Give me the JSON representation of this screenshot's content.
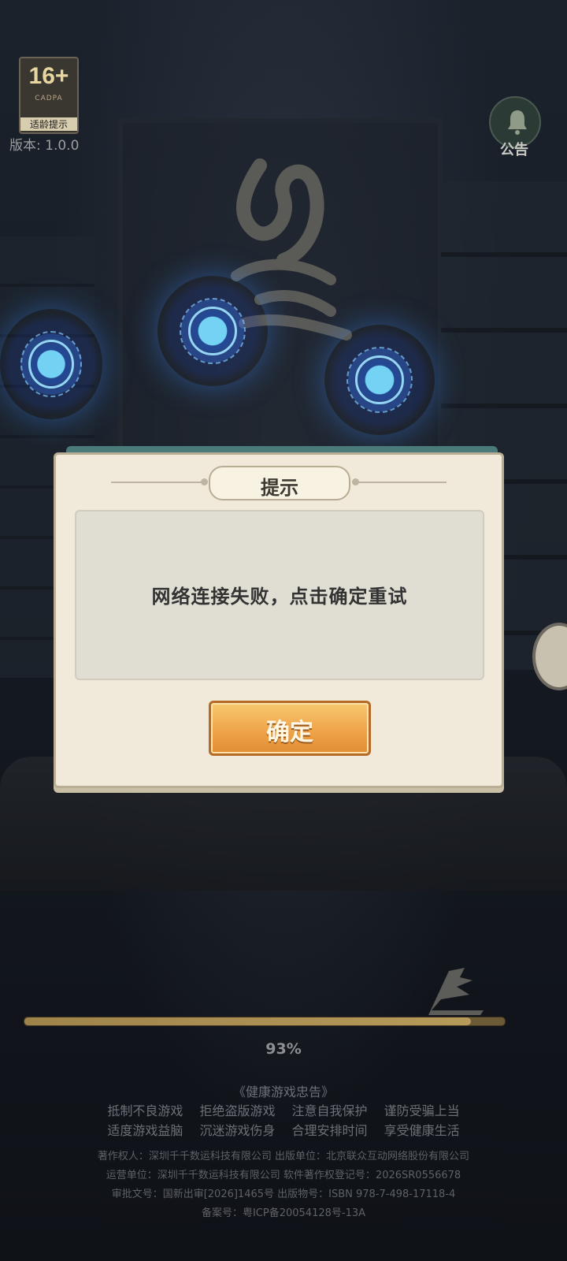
{
  "age_rating": {
    "number": "16+",
    "org": "CADPA",
    "label": "适龄提示"
  },
  "version": "版本: 1.0.0",
  "notice_button": {
    "label": "公告"
  },
  "dialog": {
    "title": "提示",
    "message": "网络连接失败，点击确定重试",
    "confirm_label": "确定"
  },
  "progress": {
    "percent": 93,
    "label": "93%"
  },
  "health_notice": {
    "title": "《健康游戏忠告》",
    "line1": [
      "抵制不良游戏",
      "拒绝盗版游戏",
      "注意自我保护",
      "谨防受骗上当"
    ],
    "line2": [
      "适度游戏益脑",
      "沉迷游戏伤身",
      "合理安排时间",
      "享受健康生活"
    ]
  },
  "footer": {
    "line1": "著作权人：深圳千千数运科技有限公司  出版单位：北京联众互动网络股份有限公司",
    "line2": "运营单位：深圳千千数运科技有限公司  软件著作权登记号：2026SR0556678",
    "line3": "审批文号：国新出审[2026]1465号  出版物号：ISBN 978-7-498-17118-4",
    "line4": "备案号：粤ICP备20054128号-13A"
  },
  "colors": {
    "accent_orange": "#eea146",
    "dialog_bg": "#f1e9d9",
    "rune_blue": "#3b7bff"
  }
}
